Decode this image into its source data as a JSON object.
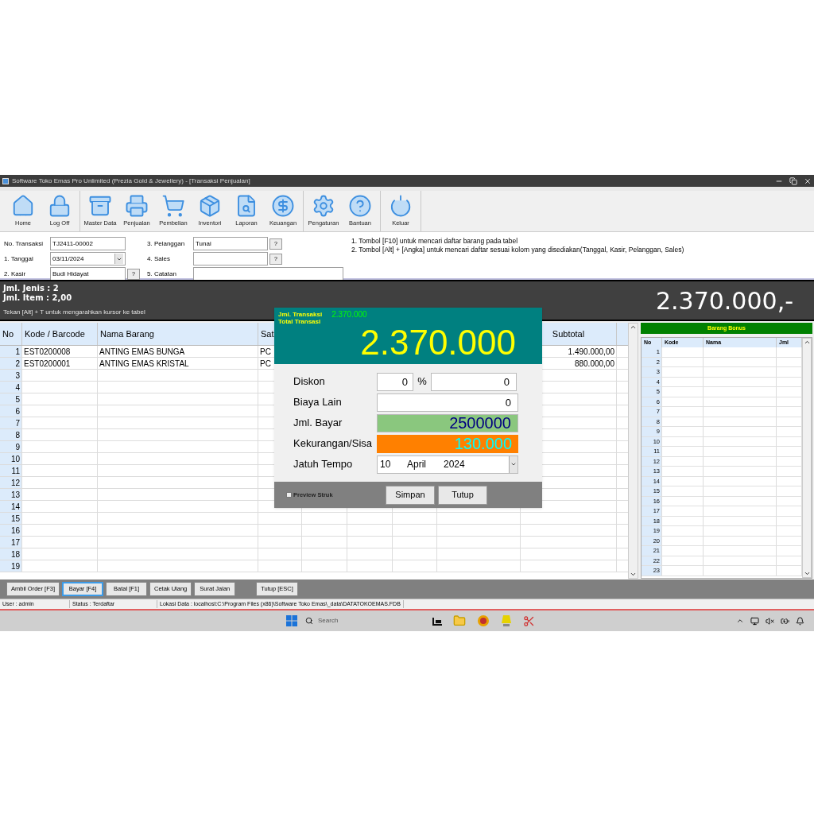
{
  "window": {
    "title": "Software Toko Emas Pro Unlimited (Prezia Gold & Jewellery) - [Transaksi Penjualan]"
  },
  "toolbar": [
    [
      {
        "kind": "home",
        "label": "Home"
      },
      {
        "kind": "lock",
        "label": "Log Off"
      }
    ],
    [
      {
        "kind": "box",
        "label": "Master Data"
      },
      {
        "kind": "printer",
        "label": "Penjualan"
      },
      {
        "kind": "cart",
        "label": "Pembelian"
      },
      {
        "kind": "package",
        "label": "Inventori"
      },
      {
        "kind": "report",
        "label": "Laporan"
      },
      {
        "kind": "money",
        "label": "Keuangan"
      }
    ],
    [
      {
        "kind": "gear",
        "label": "Pengaturan"
      },
      {
        "kind": "help",
        "label": "Bantuan"
      }
    ],
    [
      {
        "kind": "power",
        "label": "Keluar"
      }
    ]
  ],
  "form": {
    "no_transaksi": {
      "label": "No. Transaksi",
      "value": "TJ2411-00002"
    },
    "tanggal": {
      "label": "1. Tanggal",
      "value": "03/11/2024"
    },
    "kasir": {
      "label": "2. Kasir",
      "value": "Budi Hidayat",
      "button": "?"
    },
    "pelanggan": {
      "label": "3. Pelanggan",
      "value": "Tunai",
      "button": "?"
    },
    "sales": {
      "label": "4. Sales",
      "button": "?"
    },
    "catatan": {
      "label": "5. Catatan"
    },
    "hints": [
      "1. Tombol [F10] untuk mencari daftar barang pada tabel",
      "2. Tombol [Alt] + [Angka] untuk mencari daftar sesuai kolom yang disediakan(Tanggal, Kasir, Pelanggan, Sales)"
    ]
  },
  "summary": {
    "jenis": "Jml. Jenis : 2",
    "item": "Jml. Item : 2,00",
    "hint": "Tekan [Alt] + T untuk mengarahkan kursor ke tabel",
    "total": "2.370.000,-"
  },
  "table": {
    "columns": [
      "No",
      "Kode / Barcode",
      "Nama Barang",
      "Sat",
      "Subtotal"
    ],
    "rows": [
      {
        "no": "1",
        "code": "EST0200008",
        "name": "ANTING EMAS BUNGA",
        "unit": "PC",
        "subtotal": "1.490.000,00"
      },
      {
        "no": "2",
        "code": "EST0200001",
        "name": "ANTING EMAS KRISTAL",
        "unit": "PC",
        "subtotal": "880.000,00"
      },
      {
        "no": "3"
      },
      {
        "no": "4"
      },
      {
        "no": "5"
      },
      {
        "no": "6"
      },
      {
        "no": "7"
      },
      {
        "no": "8"
      },
      {
        "no": "9"
      },
      {
        "no": "10"
      },
      {
        "no": "11"
      },
      {
        "no": "12"
      },
      {
        "no": "13"
      },
      {
        "no": "14"
      },
      {
        "no": "15"
      },
      {
        "no": "16"
      },
      {
        "no": "17"
      },
      {
        "no": "18"
      },
      {
        "no": "19"
      }
    ]
  },
  "bonus": {
    "title": "Barang Bonus",
    "columns": [
      "No",
      "Kode",
      "Nama",
      "Jml"
    ],
    "rows": [
      "1",
      "2",
      "3",
      "4",
      "5",
      "6",
      "7",
      "8",
      "9",
      "10",
      "11",
      "12",
      "13",
      "14",
      "15",
      "16",
      "17",
      "18",
      "19",
      "20",
      "21",
      "22",
      "23"
    ]
  },
  "payment": {
    "count_label": "Jml. Transaksi",
    "count_value": "2.370.000",
    "total_label": "Total Transasi",
    "total": "2.370.000",
    "rows": [
      {
        "kind": "discount",
        "label": "Diskon",
        "percent": "0",
        "symbol": "%",
        "amount": "0"
      },
      {
        "kind": "plain",
        "label": "Biaya Lain",
        "value": "0"
      },
      {
        "kind": "paid",
        "label": "Jml. Bayar",
        "value": "2500000"
      },
      {
        "kind": "remaining",
        "label": "Kekurangan/Sisa",
        "value": "130.000"
      },
      {
        "kind": "date",
        "label": "Jatuh Tempo",
        "day": "10",
        "month": "April",
        "year": "2024"
      }
    ],
    "preview": {
      "label": "Preview Struk",
      "checked": false
    },
    "buttons": [
      "Simpan",
      "Tutup"
    ]
  },
  "actions": [
    [
      {
        "label": "Ambil Order [F3]",
        "selected": false
      },
      {
        "label": "Bayar [F4]",
        "selected": true
      },
      {
        "label": "Batal [F1]",
        "selected": false
      },
      {
        "label": "Cetak Ulang",
        "selected": false
      },
      {
        "label": "Surat Jalan",
        "selected": false
      }
    ],
    [
      {
        "label": "Tutup [ESC]",
        "selected": false
      }
    ]
  ],
  "status_bar": [
    "User : admin",
    "Status : Terdaftar",
    "Lokasi Data : localhost:C:\\Program Files (x86)\\Software Toko Emas\\_data\\DATATOKOEMAS.FDB"
  ],
  "taskbar": {
    "search_placeholder": "Search"
  }
}
